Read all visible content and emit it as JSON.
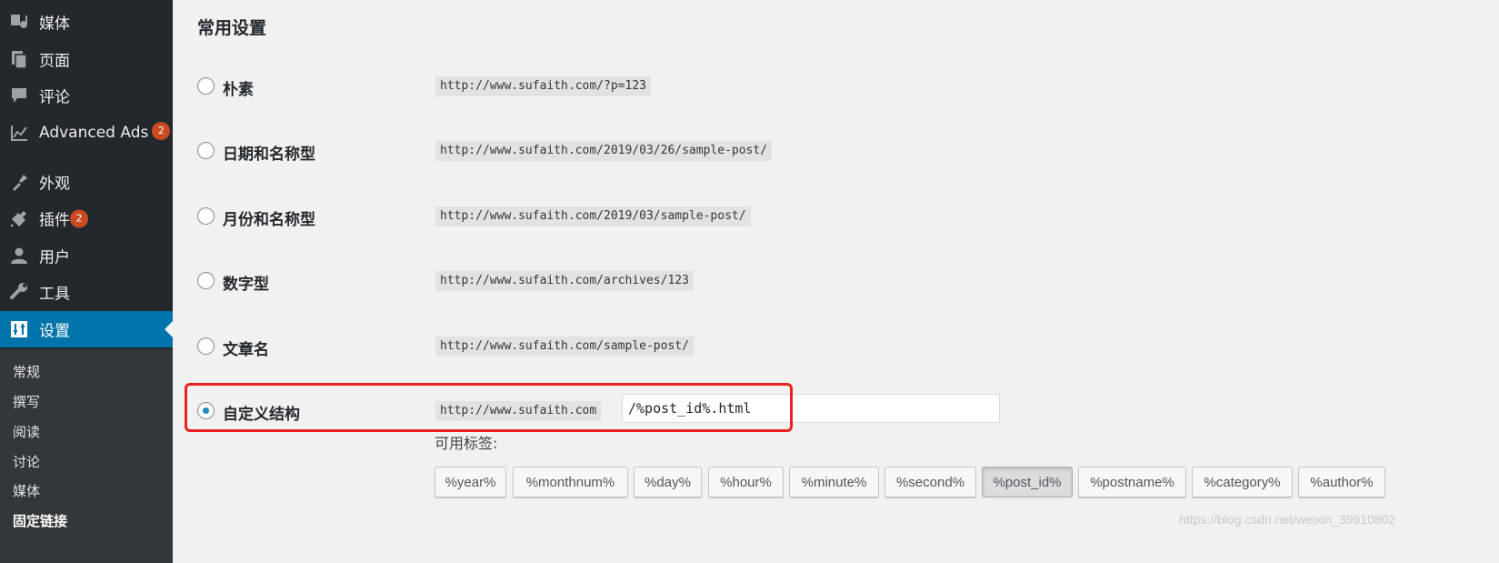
{
  "sidebar": {
    "menu": [
      {
        "label": "媒体",
        "icon": "media-icon"
      },
      {
        "label": "页面",
        "icon": "pages-icon"
      },
      {
        "label": "评论",
        "icon": "comments-icon"
      },
      {
        "label": "Advanced Ads",
        "icon": "chart-icon",
        "badge": "2"
      },
      {
        "label": "外观",
        "icon": "appearance-icon"
      },
      {
        "label": "插件",
        "icon": "plugin-icon",
        "badge": "2"
      },
      {
        "label": "用户",
        "icon": "user-icon"
      },
      {
        "label": "工具",
        "icon": "wrench-icon"
      },
      {
        "label": "设置",
        "icon": "settings-icon",
        "active": true
      }
    ],
    "submenu": [
      "常规",
      "撰写",
      "阅读",
      "讨论",
      "媒体",
      "固定链接"
    ],
    "submenu_current": "固定链接"
  },
  "main": {
    "section_title": "常用设置",
    "options": [
      {
        "label": "朴素",
        "example": "http://www.sufaith.com/?p=123",
        "checked": false
      },
      {
        "label": "日期和名称型",
        "example": "http://www.sufaith.com/2019/03/26/sample-post/",
        "checked": false
      },
      {
        "label": "月份和名称型",
        "example": "http://www.sufaith.com/2019/03/sample-post/",
        "checked": false
      },
      {
        "label": "数字型",
        "example": "http://www.sufaith.com/archives/123",
        "checked": false
      },
      {
        "label": "文章名",
        "example": "http://www.sufaith.com/sample-post/",
        "checked": false
      },
      {
        "label": "自定义结构",
        "example": "http://www.sufaith.com",
        "checked": true
      }
    ],
    "custom_structure_value": "/%post_id%.html",
    "available_tags_label": "可用标签:",
    "tags": [
      "%year%",
      "%monthnum%",
      "%day%",
      "%hour%",
      "%minute%",
      "%second%",
      "%post_id%",
      "%postname%",
      "%category%",
      "%author%"
    ],
    "pressed_tag": "%post_id%"
  },
  "colors": {
    "sidebar_bg": "#23282d",
    "submenu_bg": "#32373c",
    "active_bg": "#0073aa",
    "badge": "#ca4a1f",
    "highlight": "#e8231f"
  },
  "watermark": "https://blog.csdn.net/weixin_39910802"
}
